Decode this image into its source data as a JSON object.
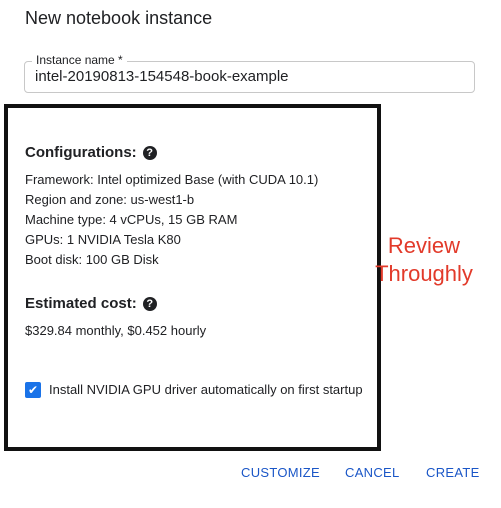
{
  "dialog": {
    "title": "New notebook instance"
  },
  "instance_name": {
    "label": "Instance name *",
    "value": "intel-20190813-154548-book-example"
  },
  "configurations": {
    "title": "Configurations:",
    "help_icon": "help-circle-icon",
    "items": [
      "Framework: Intel optimized Base (with CUDA 10.1)",
      "Region and zone: us-west1-b",
      "Machine type: 4 vCPUs, 15 GB RAM",
      "GPUs: 1 NVIDIA Tesla K80",
      "Boot disk: 100 GB Disk"
    ]
  },
  "estimated_cost": {
    "title": "Estimated cost:",
    "help_icon": "help-circle-icon",
    "value": "$329.84 monthly, $0.452 hourly"
  },
  "gpu_driver": {
    "checked": true,
    "label": "Install NVIDIA GPU driver automatically on first startup"
  },
  "annotation": {
    "line1": "Review",
    "line2": "Throughly",
    "color": "#e23a2a"
  },
  "buttons": {
    "customize": "CUSTOMIZE",
    "cancel": "CANCEL",
    "create": "CREATE"
  },
  "colors": {
    "accent": "#1a56c7",
    "checkbox": "#1a73e8"
  }
}
